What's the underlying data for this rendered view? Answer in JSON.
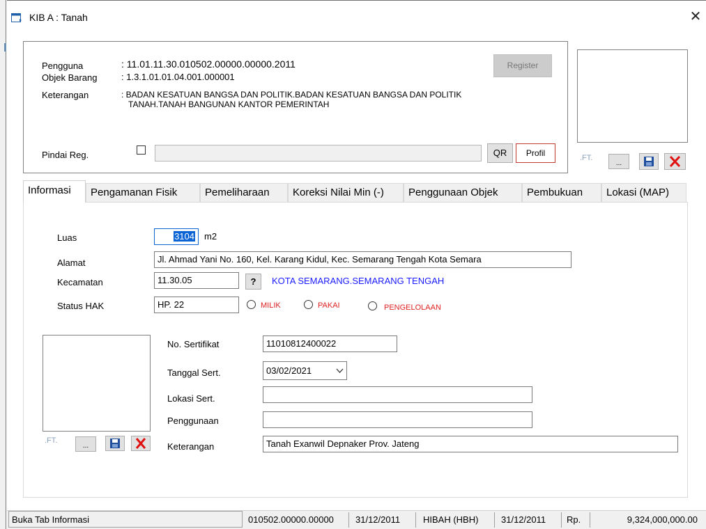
{
  "window": {
    "title": "KIB A : Tanah",
    "close_glyph": "✕"
  },
  "header": {
    "pengguna_label": "Pengguna",
    "pengguna_value": ": 11.01.11.30.010502.00000.00000.2011",
    "objek_label": "Objek Barang",
    "objek_value": ": 1.3.1.01.01.04.001.000001",
    "keterangan_label": "Keterangan",
    "keterangan_value_line1": ": BADAN  KESATUAN  BANGSA  DAN  POLITIK.BADAN KESATUAN BANGSA DAN POLITIK",
    "keterangan_value_line2": "TANAH.TANAH BANGUNAN KANTOR PEMERINTAH",
    "register_label": "Register",
    "pindai_label": "Pindai Reg.",
    "pindai_value": "",
    "qr_label": "QR",
    "profil_label": "Profil"
  },
  "photo_top": {
    "ft_label": ".FT.",
    "browse_label": "..."
  },
  "tabs": [
    {
      "label": "Informasi",
      "active": true
    },
    {
      "label": "Pengamanan Fisik"
    },
    {
      "label": "Pemeliharaan"
    },
    {
      "label": "Koreksi Nilai Min (-)"
    },
    {
      "label": "Penggunaan Objek"
    },
    {
      "label": "Pembukuan"
    },
    {
      "label": "Lokasi (MAP)"
    }
  ],
  "form": {
    "luas_label": "Luas",
    "luas_value": "3104",
    "luas_unit": "m2",
    "alamat_label": "Alamat",
    "alamat_value": "Jl. Ahmad Yani No. 160,  Kel. Karang Kidul, Kec. Semarang Tengah Kota  Semara",
    "kecamatan_label": "Kecamatan",
    "kecamatan_value": "11.30.05",
    "kecamatan_help": "?",
    "kecamatan_name": "KOTA SEMARANG.SEMARANG TENGAH",
    "status_label": "Status HAK",
    "status_value": "HP. 22",
    "radio_milik": "MILIK",
    "radio_pakai": "PAKAI",
    "radio_pengelolaan": "PENGELOLAAN",
    "sertifikat_label": "No. Sertifikat",
    "sertifikat_value": "11010812400022",
    "tanggal_label": "Tanggal Sert.",
    "tanggal_value": "03/02/2021",
    "lokasi_label": "Lokasi Sert.",
    "lokasi_value": "",
    "penggunaan_label": "Penggunaan",
    "penggunaan_value": "",
    "keterangan_label": "Keterangan",
    "keterangan_value": "Tanah Exanwil Depnaker Prov. Jateng"
  },
  "photo_bottom": {
    "ft_label": ".FT.",
    "browse_label": "..."
  },
  "status": {
    "message": "Buka Tab Informasi",
    "code": "010502.00000.00000",
    "date1": "31/12/2011",
    "acquisition": "HIBAH (HBH)",
    "date2": "31/12/2011",
    "currency": "Rp.",
    "amount": "9,324,000,000.00"
  },
  "colors": {
    "accent_blue": "#1a1aff",
    "radio_red": "#e02020",
    "delete_red": "#e01010",
    "save_blue": "#1f4e9c"
  }
}
